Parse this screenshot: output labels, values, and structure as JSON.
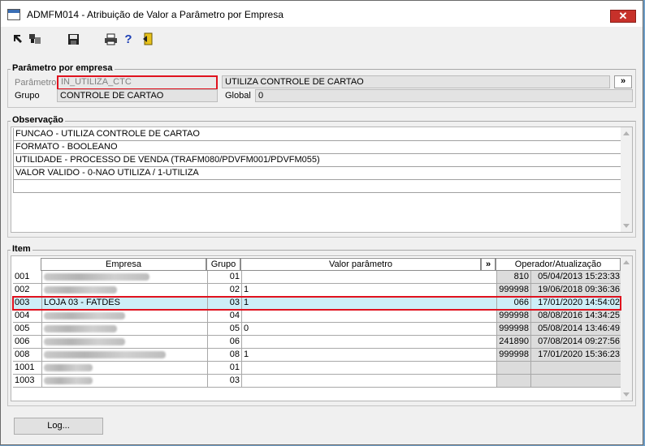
{
  "window": {
    "title": "ADMFM014 - Atribuição de Valor a Parâmetro por Empresa",
    "close_symbol": "✕"
  },
  "toolbar": {
    "buttons": [
      {
        "icon": "pointer-arrow-icon"
      },
      {
        "icon": "grid-icon"
      },
      {
        "icon": "floppy-save-icon"
      },
      {
        "icon": "printer-icon"
      },
      {
        "icon": "help-icon",
        "glyph": "?"
      },
      {
        "icon": "exit-door-icon"
      }
    ]
  },
  "param_section": {
    "title": "Parâmetro por empresa",
    "parametro_label": "Parâmetro",
    "parametro_value": "IN_UTILIZA_CTC",
    "parametro_desc": "UTILIZA CONTROLE DE CARTAO",
    "lookup_label": "»",
    "grupo_label": "Grupo",
    "grupo_value": "CONTROLE DE CARTAO",
    "global_label": "Global",
    "global_value": "0"
  },
  "obs_section": {
    "title": "Observação",
    "lines": [
      "FUNCAO - UTILIZA CONTROLE DE CARTAO",
      "FORMATO - BOOLEANO",
      "UTILIDADE - PROCESSO DE VENDA (TRAFM080/PDVFM001/PDVFM055)",
      "VALOR VALIDO - 0-NAO UTILIZA / 1-UTILIZA",
      ""
    ]
  },
  "item_section": {
    "title": "Item",
    "headers": {
      "empresa": "Empresa",
      "grupo": "Grupo",
      "valor": "Valor parâmetro",
      "expand": "»",
      "operador": "Operador/Atualização"
    },
    "rows": [
      {
        "code": "001",
        "name": "",
        "grupo": "01",
        "valor": "",
        "operador": "810",
        "data": "05/04/2013 15:23:33"
      },
      {
        "code": "002",
        "name": "",
        "grupo": "02",
        "valor": "1",
        "operador": "999998",
        "data": "19/06/2018 09:36:36"
      },
      {
        "code": "003",
        "name": "LOJA 03 - FATDES",
        "grupo": "03",
        "valor": "1",
        "operador": "066",
        "data": "17/01/2020 14:54:02"
      },
      {
        "code": "004",
        "name": "",
        "grupo": "04",
        "valor": "",
        "operador": "999998",
        "data": "08/08/2016 14:34:25"
      },
      {
        "code": "005",
        "name": "",
        "grupo": "05",
        "valor": "0",
        "operador": "999998",
        "data": "05/08/2014 13:46:49"
      },
      {
        "code": "006",
        "name": "",
        "grupo": "06",
        "valor": "",
        "operador": "241890",
        "data": "07/08/2014 09:27:56"
      },
      {
        "code": "008",
        "name": "",
        "grupo": "08",
        "valor": "1",
        "operador": "999998",
        "data": "17/01/2020 15:36:23"
      },
      {
        "code": "1001",
        "name": "",
        "grupo": "01",
        "valor": "",
        "operador": "",
        "data": ""
      },
      {
        "code": "1003",
        "name": "",
        "grupo": "03",
        "valor": "",
        "operador": "",
        "data": ""
      }
    ]
  },
  "log_button": "Log..."
}
